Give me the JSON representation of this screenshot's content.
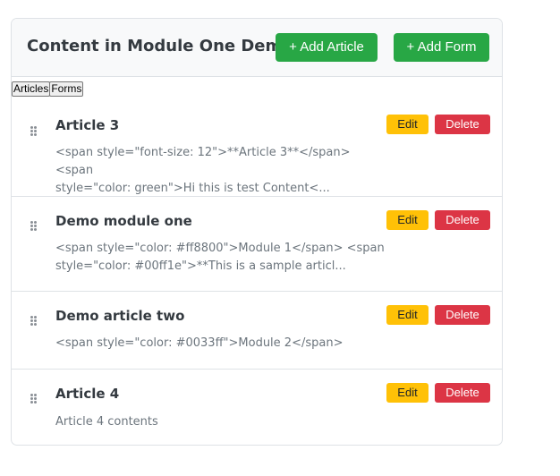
{
  "header": {
    "title": "Content in Module One Demo",
    "add_article_label": "+ Add Article",
    "add_form_label": "+ Add Form"
  },
  "tabs": [
    "Articles",
    "Forms"
  ],
  "articles": [
    {
      "title": "Article 3",
      "preview_line1": "<span style=\"font-size: 12\">**Article 3**</span> <span",
      "preview_line2": "style=\"color: green\">Hi this is test Content<..."
    },
    {
      "title": "Demo module one",
      "preview_line1": "<span style=\"color: #ff8800\">Module 1</span> <span",
      "preview_line2": "style=\"color: #00ff1e\">**This is a sample articl..."
    },
    {
      "title": "Demo article two",
      "preview_line1": "<span style=\"color: #0033ff\">Module 2</span>",
      "preview_line2": ""
    },
    {
      "title": "Article 4",
      "preview_line1": "Article 4 contents",
      "preview_line2": ""
    }
  ],
  "actions": {
    "edit_label": "Edit",
    "delete_label": "Delete"
  },
  "colors": {
    "add": "#28a745",
    "edit": "#ffc107",
    "delete": "#dc3545"
  }
}
